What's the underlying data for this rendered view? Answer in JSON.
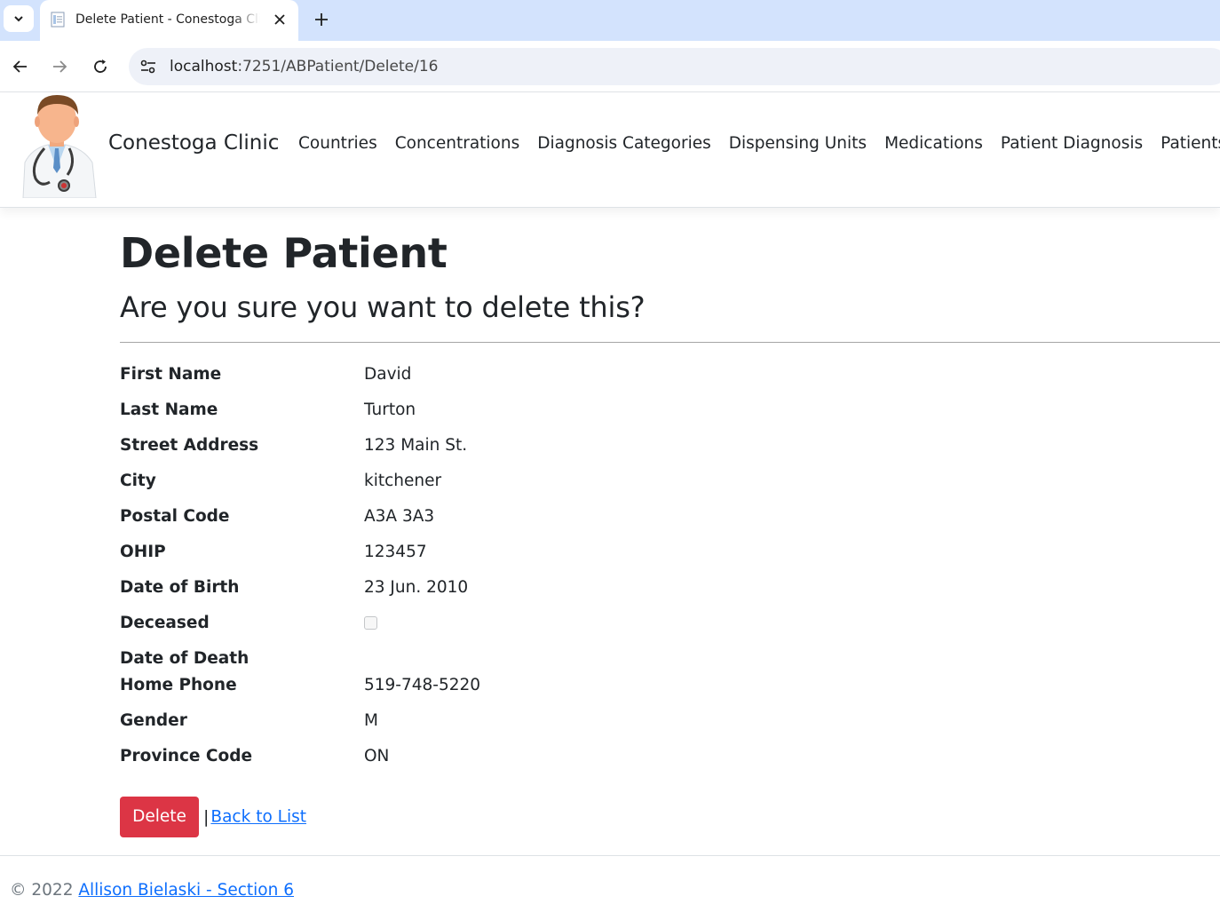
{
  "browser": {
    "tab_title": "Delete Patient - Conestoga Clinic",
    "url_host": "localhost",
    "url_path": ":7251/ABPatient/Delete/16"
  },
  "site": {
    "brand": "Conestoga Clinic",
    "nav": [
      "Countries",
      "Concentrations",
      "Diagnosis Categories",
      "Dispensing Units",
      "Medications",
      "Patient Diagnosis",
      "Patients"
    ]
  },
  "page": {
    "title": "Delete Patient",
    "subtitle": "Are you sure you want to delete this?"
  },
  "patient": {
    "fields": [
      {
        "label": "First Name",
        "value": "David"
      },
      {
        "label": "Last Name",
        "value": "Turton"
      },
      {
        "label": "Street Address",
        "value": "123 Main St."
      },
      {
        "label": "City",
        "value": "kitchener"
      },
      {
        "label": "Postal Code",
        "value": "A3A 3A3"
      },
      {
        "label": "OHIP",
        "value": "123457"
      },
      {
        "label": "Date of Birth",
        "value": "23 Jun. 2010"
      },
      {
        "label": "Deceased",
        "value": ""
      },
      {
        "label": "Date of Death",
        "value": ""
      },
      {
        "label": "Home Phone",
        "value": "519-748-5220"
      },
      {
        "label": "Gender",
        "value": "M"
      },
      {
        "label": "Province Code",
        "value": "ON"
      }
    ],
    "deceased_checked": false
  },
  "actions": {
    "delete_label": "Delete",
    "separator": "|",
    "back_label": "Back to List"
  },
  "footer": {
    "copyright": "© 2022",
    "author_link": "Allison Bielaski - Section 6"
  },
  "colors": {
    "danger": "#dc3545",
    "link": "#0d6efd",
    "tabbar": "#d3e3fd"
  }
}
